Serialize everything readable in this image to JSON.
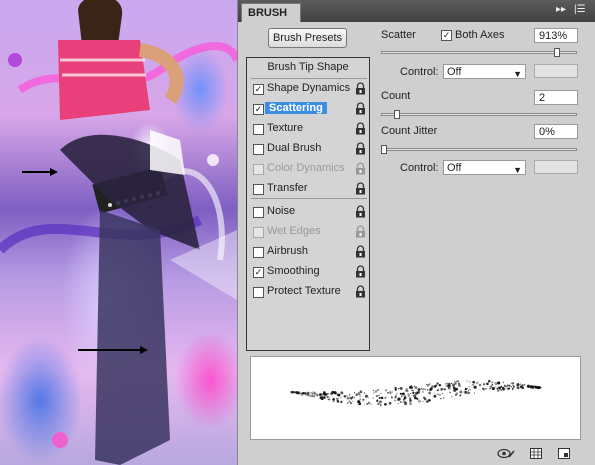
{
  "panel": {
    "tab_title": "BRUSH",
    "presets_button": "Brush Presets",
    "list_header": "Brush Tip Shape",
    "items": [
      {
        "label": "Shape Dynamics",
        "checked": true,
        "selected": false,
        "disabled": false
      },
      {
        "label": "Scattering",
        "checked": true,
        "selected": true,
        "disabled": false
      },
      {
        "label": "Texture",
        "checked": false,
        "selected": false,
        "disabled": false
      },
      {
        "label": "Dual Brush",
        "checked": false,
        "selected": false,
        "disabled": false
      },
      {
        "label": "Color Dynamics",
        "checked": false,
        "selected": false,
        "disabled": true
      },
      {
        "label": "Transfer",
        "checked": false,
        "selected": false,
        "disabled": false
      },
      {
        "label": "Noise",
        "checked": false,
        "selected": false,
        "disabled": false
      },
      {
        "label": "Wet Edges",
        "checked": false,
        "selected": false,
        "disabled": true
      },
      {
        "label": "Airbrush",
        "checked": false,
        "selected": false,
        "disabled": false
      },
      {
        "label": "Smoothing",
        "checked": true,
        "selected": false,
        "disabled": false
      },
      {
        "label": "Protect Texture",
        "checked": false,
        "selected": false,
        "disabled": false
      }
    ],
    "check_mark": "✓"
  },
  "options": {
    "scatter_label": "Scatter",
    "both_axes_label": "Both Axes",
    "both_axes_checked": true,
    "scatter_value": "913%",
    "scatter_slider_level": 0.913,
    "control_label": "Control:",
    "control1_value": "Off",
    "count_label": "Count",
    "count_value": "2",
    "count_slider_level": 0.07,
    "count_jitter_label": "Count Jitter",
    "count_jitter_value": "0%",
    "count_jitter_slider_level": 0.0,
    "control2_value": "Off"
  },
  "icons": {
    "tab_collapse": "double-chevron-right-icon",
    "tab_menu": "panel-menu-icon",
    "lock": "lock-icon",
    "dropdown_arrow": "▼",
    "bottom": [
      "eye-preview-icon",
      "grid-icon",
      "new-preset-icon"
    ]
  },
  "colors": {
    "selection": "#3d8ee0",
    "panel_bg": "#cfcfcf",
    "tabbar": "#4a4a4a"
  }
}
